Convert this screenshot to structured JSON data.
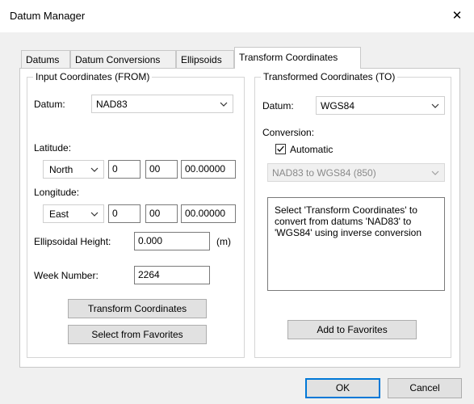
{
  "window": {
    "title": "Datum Manager",
    "close_glyph": "✕"
  },
  "tabs": [
    "Datums",
    "Datum Conversions",
    "Ellipsoids",
    "Transform Coordinates"
  ],
  "active_tab": "Transform Coordinates",
  "input": {
    "group_title": "Input Coordinates (FROM)",
    "datum_label": "Datum:",
    "datum_value": "NAD83",
    "latitude_label": "Latitude:",
    "latitude": {
      "hemisphere": "North",
      "degrees": "0",
      "minutes": "00",
      "seconds": "00.00000"
    },
    "longitude_label": "Longitude:",
    "longitude": {
      "hemisphere": "East",
      "degrees": "0",
      "minutes": "00",
      "seconds": "00.00000"
    },
    "height_label": "Ellipsoidal Height:",
    "height_value": "0.000",
    "height_unit": "(m)",
    "week_label": "Week Number:",
    "week_value": "2264",
    "transform_button": "Transform Coordinates",
    "favorites_button": "Select from Favorites"
  },
  "output": {
    "group_title": "Transformed Coordinates (TO)",
    "datum_label": "Datum:",
    "datum_value": "WGS84",
    "conversion_label": "Conversion:",
    "automatic_label": "Automatic",
    "automatic_checked": true,
    "conversion_value": "NAD83 to WGS84 (850)",
    "message": "Select 'Transform Coordinates' to convert from datums 'NAD83' to 'WGS84' using inverse conversion",
    "add_favorites_button": "Add to Favorites"
  },
  "footer": {
    "ok": "OK",
    "cancel": "Cancel"
  }
}
